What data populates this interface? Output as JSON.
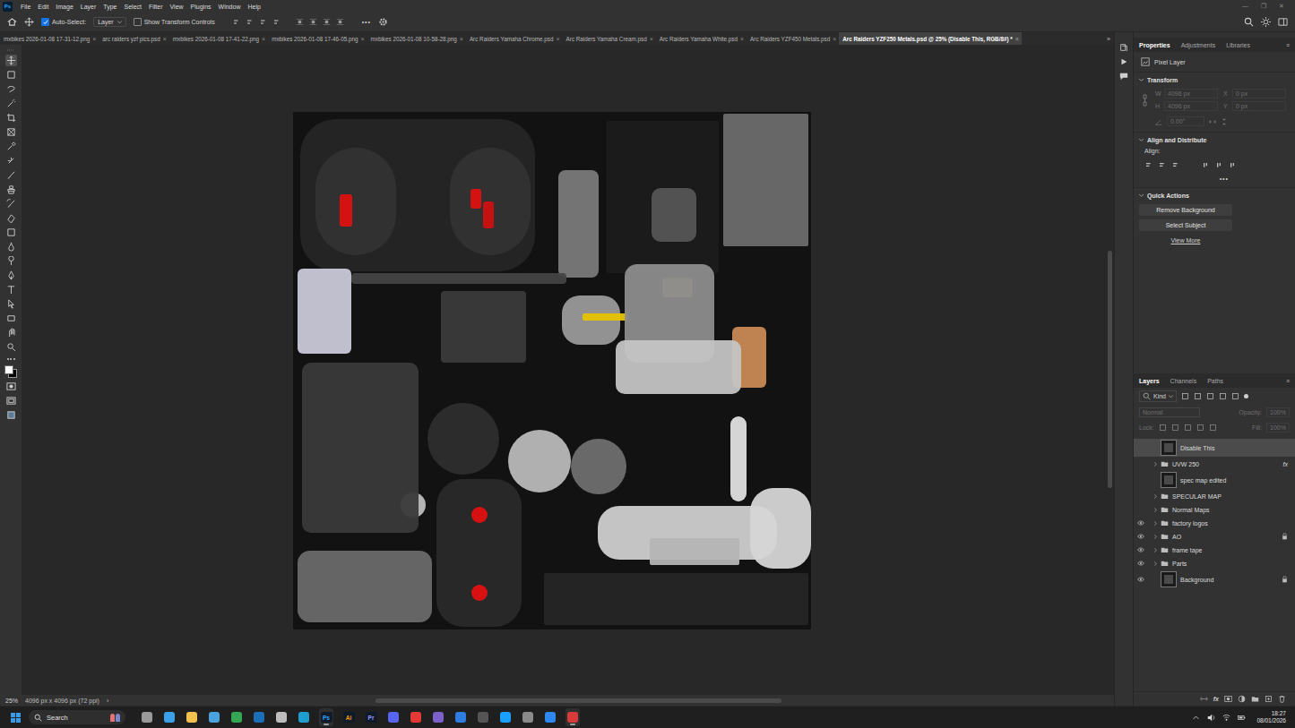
{
  "menu_bar": {
    "logo": "Ps",
    "items": [
      "File",
      "Edit",
      "Image",
      "Layer",
      "Type",
      "Select",
      "Filter",
      "View",
      "Plugins",
      "Window",
      "Help"
    ],
    "window_controls": [
      "—",
      "❐",
      "✕"
    ]
  },
  "options_bar": {
    "auto_select": {
      "label": "Auto-Select:",
      "checked": true
    },
    "target": "Layer",
    "transform_controls": {
      "label": "Show Transform Controls",
      "checked": false
    },
    "more": "•••"
  },
  "document_tabs": {
    "items": [
      {
        "label": "mxbikes 2026-01-08 17-31-12.png",
        "close": "×",
        "selected": false
      },
      {
        "label": "arc raiders yzf pics.psd",
        "close": "×",
        "selected": false
      },
      {
        "label": "mxbikes 2026-01-08 17-41-22.png",
        "close": "×",
        "selected": false
      },
      {
        "label": "mxbikes 2026-01-08 17-46-05.png",
        "close": "×",
        "selected": false
      },
      {
        "label": "mxbikes 2026-01-08 10-58-28.png",
        "close": "×",
        "selected": false
      },
      {
        "label": "Arc Raiders Yamaha Chrome.psd",
        "close": "×",
        "selected": false
      },
      {
        "label": "Arc Raiders Yamaha Cream.psd",
        "close": "×",
        "selected": false
      },
      {
        "label": "Arc Raiders Yamaha White.psd",
        "close": "×",
        "selected": false
      },
      {
        "label": "Arc Raiders YZF450 Metals.psd",
        "close": "×",
        "selected": false
      },
      {
        "label": "Arc Raiders YZF250 Metals.psd @ 25% (Disable This, RGB/8#) *",
        "close": "×",
        "selected": true
      }
    ],
    "overflow": "»"
  },
  "status_bar": {
    "zoom": "25%",
    "doc_info": "4096 px x 4096 px (72 ppi)",
    "arrow": "›"
  },
  "properties_panel": {
    "tabs": [
      {
        "label": "Properties",
        "selected": true
      },
      {
        "label": "Adjustments",
        "selected": false
      },
      {
        "label": "Libraries",
        "selected": false
      }
    ],
    "menu": "≡",
    "layer_kind": "Pixel Layer",
    "transform": {
      "title": "Transform",
      "disabled": true,
      "fields": [
        {
          "label": "W",
          "value": "4096 px"
        },
        {
          "label": "X",
          "value": "0 px"
        },
        {
          "label": "H",
          "value": "4096 px"
        },
        {
          "label": "Y",
          "value": "0 px"
        }
      ],
      "angle": "0.00°"
    },
    "align": {
      "title": "Align and Distribute",
      "label": "Align:",
      "more": "•••"
    },
    "quick_actions": {
      "title": "Quick Actions",
      "buttons": [
        "Remove Background",
        "Select Subject"
      ],
      "link": "View More"
    }
  },
  "layers_panel": {
    "tabs": [
      {
        "label": "Layers",
        "selected": true
      },
      {
        "label": "Channels",
        "selected": false
      },
      {
        "label": "Paths",
        "selected": false
      }
    ],
    "menu": "≡",
    "filter": "Kind",
    "blend_mode": "Normal",
    "opacity_label": "Opacity:",
    "opacity": "100%",
    "lock_label": "Lock:",
    "fill_label": "Fill:",
    "fill": "100%",
    "controls_disabled": true,
    "layers": [
      {
        "name": "Disable This",
        "kind": "pixel",
        "visible": false,
        "selected": true,
        "locked": false,
        "badge": ""
      },
      {
        "name": "UVW 250",
        "kind": "group",
        "visible": false,
        "selected": false,
        "locked": false,
        "badge": "fx"
      },
      {
        "name": "spec map edited",
        "kind": "pixel",
        "visible": false,
        "selected": false,
        "locked": false,
        "badge": ""
      },
      {
        "name": "SPECULAR MAP",
        "kind": "group",
        "visible": false,
        "selected": false,
        "locked": false,
        "badge": ""
      },
      {
        "name": "Normal Maps",
        "kind": "group",
        "visible": false,
        "selected": false,
        "locked": false,
        "badge": ""
      },
      {
        "name": "factory logos",
        "kind": "group",
        "visible": true,
        "selected": false,
        "locked": false,
        "badge": ""
      },
      {
        "name": "AO",
        "kind": "group",
        "visible": true,
        "selected": false,
        "locked": true,
        "badge": ""
      },
      {
        "name": "frame tape",
        "kind": "group",
        "visible": true,
        "selected": false,
        "locked": false,
        "badge": ""
      },
      {
        "name": "Parts",
        "kind": "group",
        "visible": true,
        "selected": false,
        "locked": false,
        "badge": ""
      },
      {
        "name": "Background",
        "kind": "pixel",
        "visible": true,
        "selected": false,
        "locked": true,
        "badge": ""
      }
    ],
    "footer_fx": "fx"
  },
  "taskbar": {
    "search": "Search",
    "time": "18:27",
    "date": "08/01/2026",
    "apps": [
      {
        "label": "",
        "color": "#9a9a9a",
        "active": false
      },
      {
        "label": "",
        "color": "#3aa0e8",
        "active": false
      },
      {
        "label": "",
        "color": "#f2c14e",
        "active": false
      },
      {
        "label": "",
        "color": "#4aa3df",
        "active": false
      },
      {
        "label": "",
        "color": "#34a853",
        "active": false
      },
      {
        "label": "",
        "color": "#1b6fb8",
        "active": false
      },
      {
        "label": "",
        "color": "#bdbdbd",
        "active": false
      },
      {
        "label": "",
        "color": "#1e9fd0",
        "active": false
      },
      {
        "label": "Ps",
        "color": "#31a8ff",
        "active": true
      },
      {
        "label": "Ai",
        "color": "#ff9a00",
        "active": false
      },
      {
        "label": "Pr",
        "color": "#9999ff",
        "active": false
      },
      {
        "label": "",
        "color": "#5865f2",
        "active": false
      },
      {
        "label": "",
        "color": "#e53935",
        "active": false
      },
      {
        "label": "",
        "color": "#7b61c9",
        "active": false
      },
      {
        "label": "",
        "color": "#2f7de1",
        "active": false
      },
      {
        "label": "",
        "color": "#555555",
        "active": false
      },
      {
        "label": "",
        "color": "#1a9fff",
        "active": false
      },
      {
        "label": "",
        "color": "#8a8a8a",
        "active": false
      },
      {
        "label": "",
        "color": "#2d89ef",
        "active": false
      },
      {
        "label": "",
        "color": "#d93b3b",
        "active": true
      }
    ]
  }
}
